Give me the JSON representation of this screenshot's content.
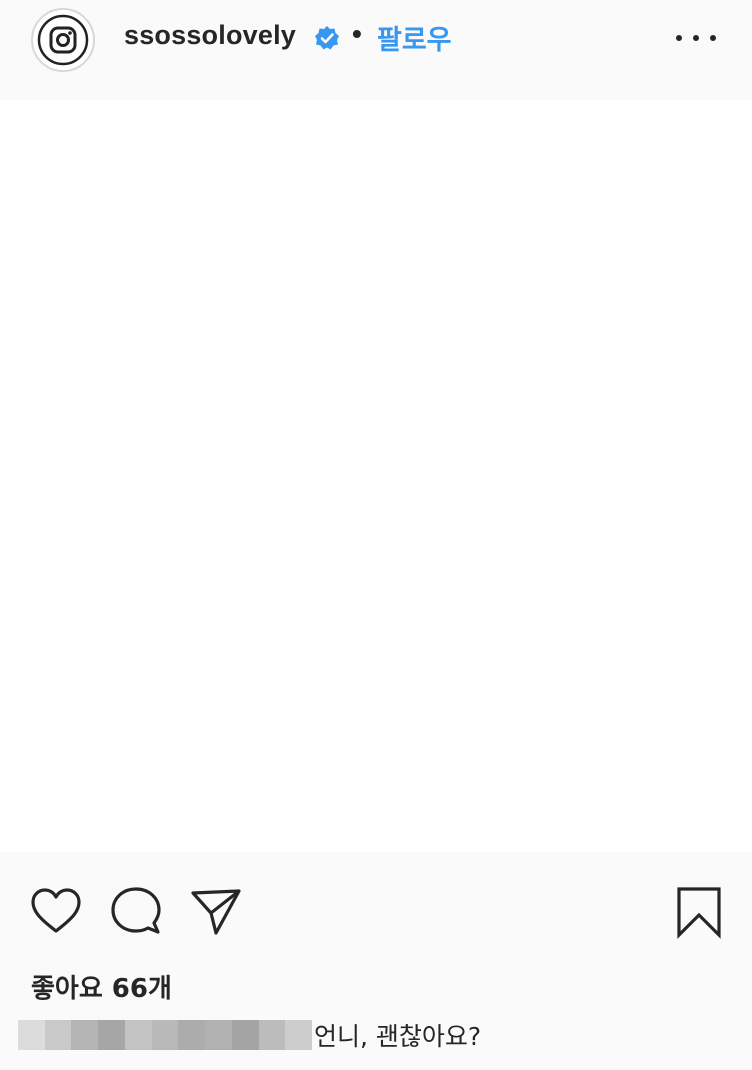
{
  "header": {
    "username": "ssossolovely",
    "separator": "•",
    "follow_label": "팔로우",
    "avatar_icon": "instagram-logo-icon",
    "verified_icon": "verified-badge-icon",
    "more_icon": "more-options-icon",
    "verified_color": "#3897f0"
  },
  "post": {
    "image_description": ""
  },
  "actions": {
    "like_icon": "heart-icon",
    "comment_icon": "comment-icon",
    "share_icon": "send-icon",
    "save_icon": "bookmark-icon"
  },
  "likes": {
    "text": "좋아요 66개"
  },
  "comment": {
    "text": "언니, 괜찮아요?"
  },
  "colors": {
    "accent": "#3897f0",
    "text": "#262626",
    "background": "#fafafa"
  }
}
